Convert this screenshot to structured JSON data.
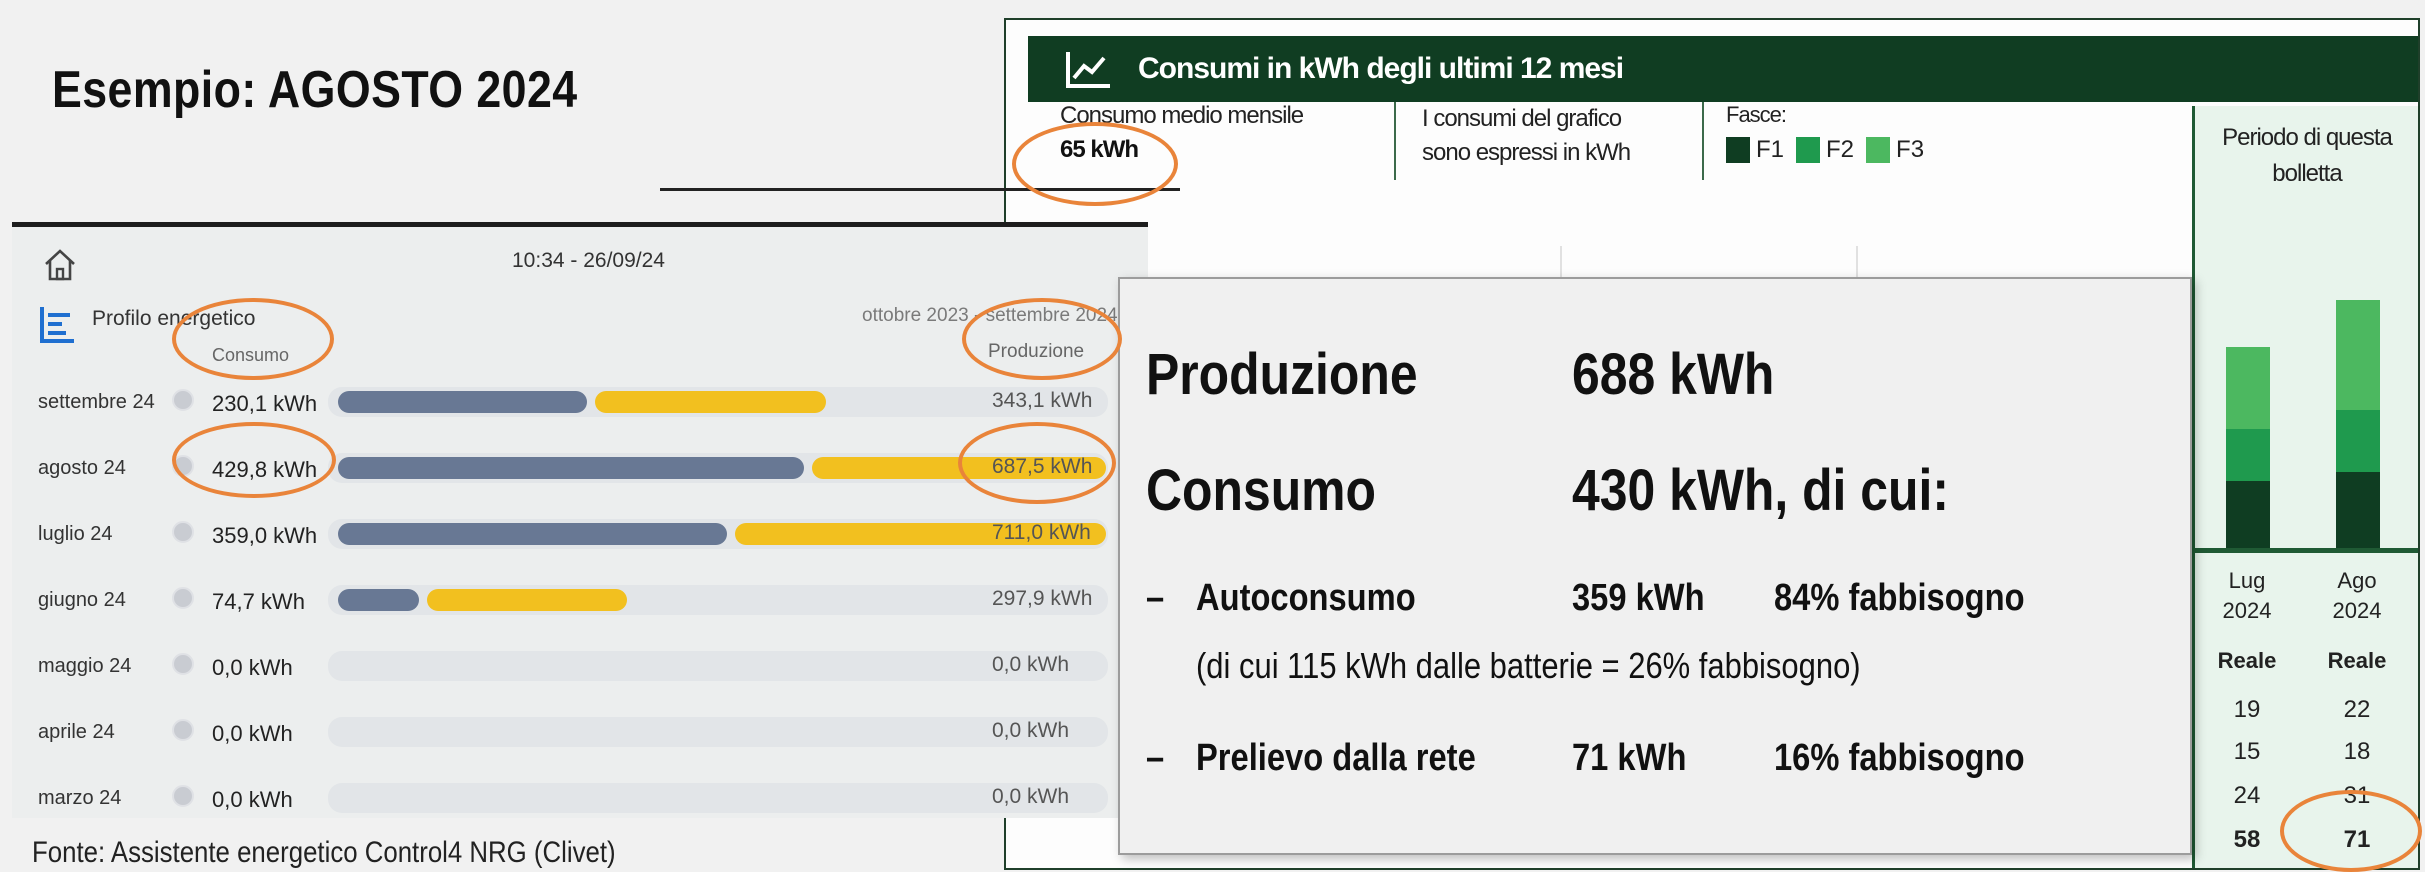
{
  "slide": {
    "title": "Esempio: AGOSTO 2024",
    "source": "Fonte: Assistente energetico Control4 NRG (Clivet)"
  },
  "tablet": {
    "clock": "10:34 - 26/09/24",
    "profile_label": "Profilo energetico",
    "period": "ottobre 2023 - settembre 2024",
    "col_consumption": "Consumo",
    "col_production": "Produzione",
    "rows": [
      {
        "month": "settembre 24",
        "consumption": "230,1 kWh",
        "production": "343,1 kWh",
        "c_kwh": 230.1,
        "p_kwh": 343.1
      },
      {
        "month": "agosto 24",
        "consumption": "429,8 kWh",
        "production": "687,5 kWh",
        "c_kwh": 429.8,
        "p_kwh": 687.5
      },
      {
        "month": "luglio 24",
        "consumption": "359,0 kWh",
        "production": "711,0 kWh",
        "c_kwh": 359.0,
        "p_kwh": 711.0
      },
      {
        "month": "giugno 24",
        "consumption": "74,7 kWh",
        "production": "297,9 kWh",
        "c_kwh": 74.7,
        "p_kwh": 297.9
      },
      {
        "month": "maggio 24",
        "consumption": "0,0 kWh",
        "production": "0,0 kWh",
        "c_kwh": 0,
        "p_kwh": 0
      },
      {
        "month": "aprile 24",
        "consumption": "0,0 kWh",
        "production": "0,0 kWh",
        "c_kwh": 0,
        "p_kwh": 0
      },
      {
        "month": "marzo 24",
        "consumption": "0,0 kWh",
        "production": "0,0 kWh",
        "c_kwh": 0,
        "p_kwh": 0
      }
    ],
    "colors": {
      "consumption": "#687894",
      "production": "#f2c01f"
    }
  },
  "bill": {
    "header_title": "Consumi in kWh degli ultimi 12 mesi",
    "avg_label": "Consumo medio mensile",
    "avg_value": "65 kWh",
    "unit_note_1": "I consumi del grafico",
    "unit_note_2": "sono espressi in kWh",
    "fasce_label": "Fasce:",
    "fasce": [
      "F1",
      "F2",
      "F3"
    ],
    "fasce_colors": [
      "#0f3d22",
      "#1f9a4e",
      "#4cb860"
    ],
    "periodo_1": "Periodo di questa",
    "periodo_2": "bolletta",
    "months": [
      {
        "m": "Lug",
        "y": "2024",
        "status": "Reale",
        "f1": "19",
        "f2": "15",
        "f3": "24",
        "tot": "58"
      },
      {
        "m": "Ago",
        "y": "2024",
        "status": "Reale",
        "f1": "22",
        "f2": "18",
        "f3": "31",
        "tot": "71"
      }
    ]
  },
  "overlay": {
    "prod_label": "Produzione",
    "prod_value": "688 kWh",
    "cons_label": "Consumo",
    "cons_value": "430 kWh, di cui:",
    "dash": "–",
    "auto_label": "Autoconsumo",
    "auto_value": "359 kWh",
    "auto_pct": "84% fabbisogno",
    "batt_note": "(di cui 115 kWh dalle batterie = 26% fabbisogno)",
    "grid_label": "Prelievo dalla rete",
    "grid_value": "71 kWh",
    "grid_pct": "16% fabbisogno"
  },
  "highlight_color": "#e9843a"
}
